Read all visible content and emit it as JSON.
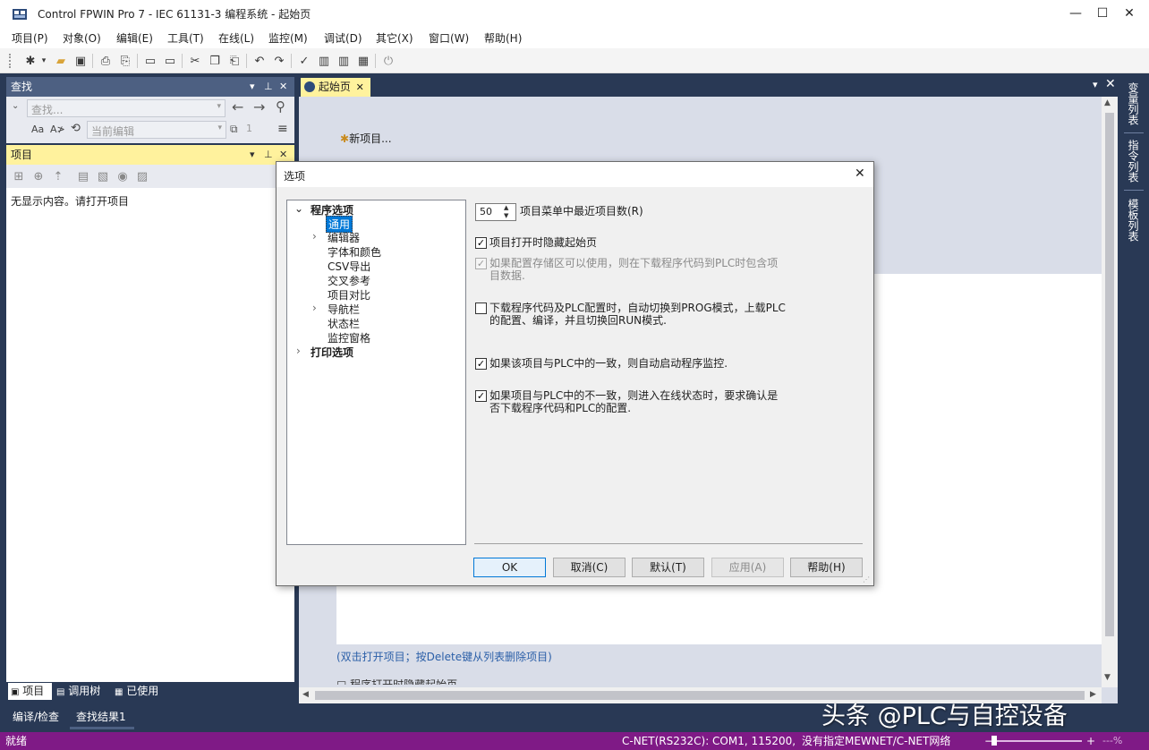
{
  "window": {
    "title": "Control FPWIN Pro 7 - IEC 61131-3 编程系统 - 起始页",
    "minimize": "—",
    "maximize": "☐",
    "close": "✕"
  },
  "menu": [
    "项目(P)",
    "对象(O)",
    "编辑(E)",
    "工具(T)",
    "在线(L)",
    "监控(M)",
    "调试(D)",
    "其它(X)",
    "窗口(W)",
    "帮助(H)"
  ],
  "find_panel": {
    "title": "查找",
    "search_placeholder": "查找...",
    "scope_placeholder": "当前编辑",
    "count": "1",
    "option_case": "Aa",
    "option_word": "A≯"
  },
  "project_panel": {
    "title": "项目",
    "empty_text": "无显示内容。请打开项目"
  },
  "left_tabs": [
    "项目",
    "调用树",
    "已使用"
  ],
  "output_tabs": [
    "编译/检查",
    "查找结果1"
  ],
  "doc_tab": {
    "label": "起始页"
  },
  "start_page": {
    "new_project": "新项目...",
    "hint": "(双击打开项目；按Delete键从列表删除项目)",
    "cutoff_text": "□ 程序打开时隐藏起始页"
  },
  "right_side_tabs": [
    "变量列表",
    "指令列表",
    "模板列表"
  ],
  "dialog": {
    "title": "选项",
    "tree": [
      {
        "label": "程序选项",
        "level": 0,
        "expanded": true,
        "bold": true
      },
      {
        "label": "通用",
        "level": 1,
        "selected": true
      },
      {
        "label": "编辑器",
        "level": 1,
        "expandable": true
      },
      {
        "label": "字体和颜色",
        "level": 1
      },
      {
        "label": "CSV导出",
        "level": 1
      },
      {
        "label": "交叉参考",
        "level": 1
      },
      {
        "label": "项目对比",
        "level": 1
      },
      {
        "label": "导航栏",
        "level": 1,
        "expandable": true
      },
      {
        "label": "状态栏",
        "level": 1
      },
      {
        "label": "监控窗格",
        "level": 1
      },
      {
        "label": "打印选项",
        "level": 0,
        "expandable": true,
        "bold": true
      }
    ],
    "recent_count": "50",
    "recent_label": "项目菜单中最近项目数(R)",
    "options": [
      {
        "checked": true,
        "disabled": false,
        "text": "项目打开时隐藏起始页"
      },
      {
        "checked": true,
        "disabled": true,
        "text": "如果配置存储区可以使用，则在下载程序代码到PLC时包含项目数据."
      },
      {
        "checked": false,
        "disabled": false,
        "text": "下载程序代码及PLC配置时，自动切换到PROG模式，上载PLC的配置、编译，并且切换回RUN模式."
      },
      {
        "checked": true,
        "disabled": false,
        "text": "如果该项目与PLC中的一致，则自动启动程序监控."
      },
      {
        "checked": true,
        "disabled": false,
        "text": "如果项目与PLC中的不一致，则进入在线状态时，要求确认是否下载程序代码和PLC的配置."
      }
    ],
    "buttons": {
      "ok": "OK",
      "cancel": "取消(C)",
      "default": "默认(T)",
      "apply": "应用(A)",
      "help": "帮助(H)"
    }
  },
  "status": {
    "left": "就绪",
    "connection": "C-NET(RS232C): COM1, 115200, 8",
    "network": "没有指定MEWNET/C-NET网络",
    "zoom": "---%"
  },
  "watermark": "头条 @PLC与自控设备",
  "colors": {
    "accent_dark": "#293955",
    "status_bar": "#7f1a86",
    "panel_yellow": "#fff29d",
    "selection": "#0078d7"
  }
}
